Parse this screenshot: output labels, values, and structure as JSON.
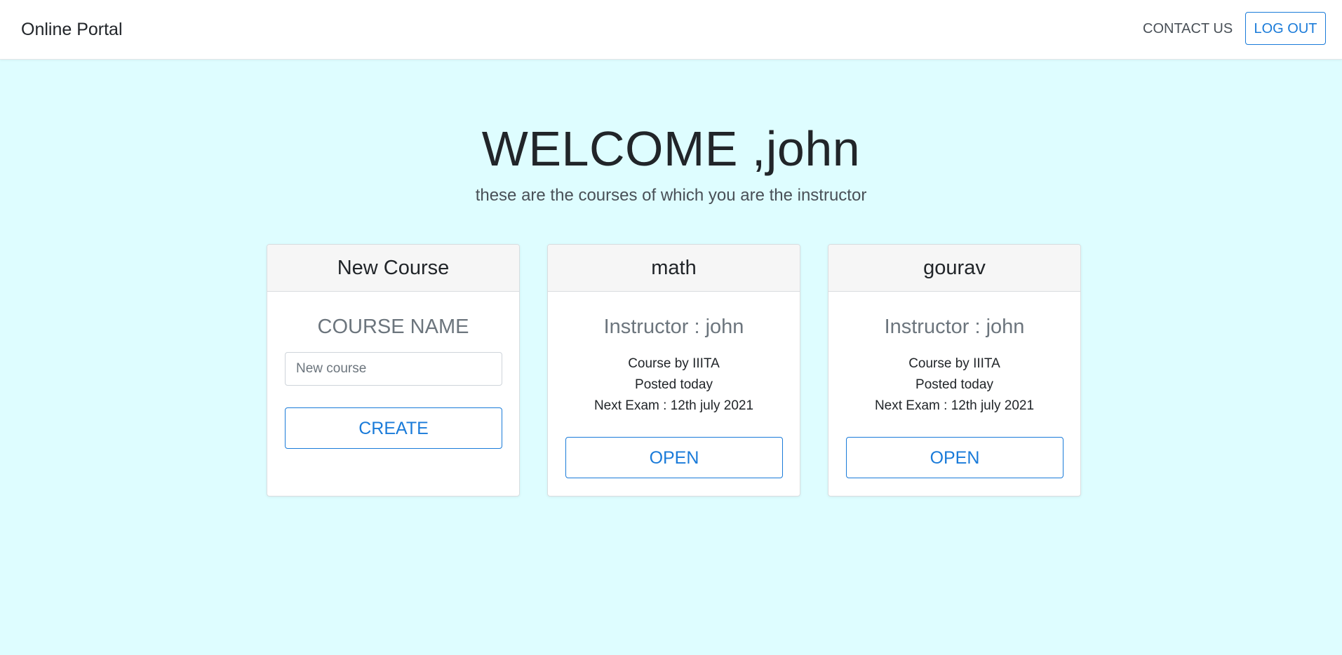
{
  "navbar": {
    "brand": "Online Portal",
    "contact_label": "CONTACT US",
    "logout_label": "LOG OUT"
  },
  "hero": {
    "welcome": "WELCOME ,john",
    "subtitle": "these are the courses of which you are the instructor"
  },
  "new_course_card": {
    "header": "New Course",
    "label": "COURSE NAME",
    "input_value": "",
    "input_placeholder": "New course",
    "create_label": "CREATE"
  },
  "courses": [
    {
      "header": "math",
      "instructor": "Instructor : john",
      "by": "Course by IIITA",
      "posted": "Posted today",
      "next_exam": "Next Exam : 12th july 2021",
      "open_label": "OPEN"
    },
    {
      "header": "gourav",
      "instructor": "Instructor : john",
      "by": "Course by IIITA",
      "posted": "Posted today",
      "next_exam": "Next Exam : 12th july 2021",
      "open_label": "OPEN"
    }
  ],
  "colors": {
    "background": "#defdff",
    "accent": "#1a7bd9",
    "card_header": "#f6f6f6"
  }
}
